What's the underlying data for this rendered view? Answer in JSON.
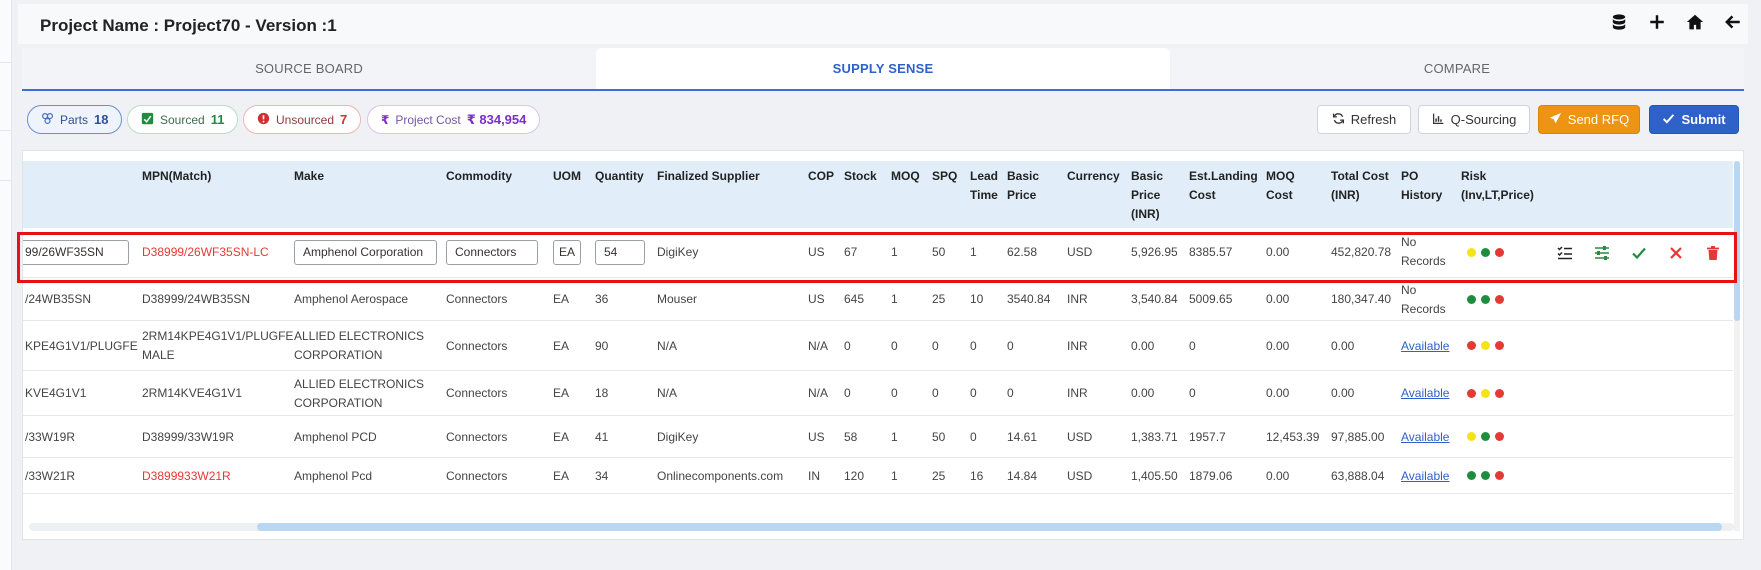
{
  "header": {
    "title": "Project Name : Project70 - Version :1"
  },
  "tabs": [
    {
      "label": "SOURCE BOARD",
      "active": false
    },
    {
      "label": "SUPPLY SENSE",
      "active": true
    },
    {
      "label": "COMPARE",
      "active": false
    }
  ],
  "stats": {
    "parts": {
      "label": "Parts",
      "value": "18"
    },
    "sourced": {
      "label": "Sourced",
      "value": "11"
    },
    "unsourced": {
      "label": "Unsourced",
      "value": "7"
    },
    "cost": {
      "label": "Project Cost",
      "value": "₹ 834,954"
    }
  },
  "buttons": {
    "refresh": "Refresh",
    "qsourcing": "Q-Sourcing",
    "send_rfq": "Send RFQ",
    "submit": "Submit"
  },
  "table": {
    "headers": {
      "mpn_match": "MPN(Match)",
      "make": "Make",
      "commodity": "Commodity",
      "uom": "UOM",
      "quantity": "Quantity",
      "supplier": "Finalized Supplier",
      "cop": "COP",
      "stock": "Stock",
      "moq": "MOQ",
      "spq": "SPQ",
      "lead_time": [
        "Lead",
        "Time"
      ],
      "basic_price": [
        "Basic",
        "Price"
      ],
      "currency": "Currency",
      "basic_price_inr": [
        "Basic",
        "Price",
        "(INR)"
      ],
      "est_landing": [
        "Est.Landing",
        "Cost"
      ],
      "moq_cost": [
        "MOQ",
        "Cost"
      ],
      "total_cost": [
        "Total Cost",
        "(INR)"
      ],
      "po_history": [
        "PO",
        "History"
      ],
      "risk": [
        "Risk",
        "(Inv,LT,Price)"
      ]
    },
    "edit_row": {
      "mpn_input": "99/26WF35SN",
      "mpn_match": "D38999/26WF35SN-LC",
      "make_input": "Amphenol Corporation",
      "commodity_input": "Connectors",
      "uom_input": "EA",
      "qty_input": "54",
      "supplier": "DigiKey",
      "cop": "US",
      "stock": "67",
      "moq": "1",
      "spq": "50",
      "lead": "1",
      "basic_price": "62.58",
      "currency": "USD",
      "basic_inr": "5,926.95",
      "est_landing": "8385.57",
      "moq_cost": "0.00",
      "total_cost": "452,820.78",
      "po_history": [
        "No",
        "Records"
      ],
      "risk": [
        "#f5e21b",
        "#1e8e3e",
        "#e53935"
      ]
    },
    "rows": [
      {
        "mpn": "/24WB35SN",
        "match": [
          "D38999/24WB35SN"
        ],
        "match_red": false,
        "make": [
          "Amphenol Aerospace"
        ],
        "commodity": "Connectors",
        "uom": "EA",
        "qty": "36",
        "supplier": "Mouser",
        "cop": "US",
        "stock": "645",
        "moq": "1",
        "spq": "25",
        "lead": "10",
        "basic_price": "3540.84",
        "currency": "INR",
        "basic_inr": "3,540.84",
        "est_landing": "5009.65",
        "moq_cost": "0.00",
        "total_cost": "180,347.40",
        "po_history": [
          "No",
          "Records"
        ],
        "po_link": false,
        "risk": [
          "#1e8e3e",
          "#1e8e3e",
          "#e53935"
        ]
      },
      {
        "mpn": "KPE4G1V1/PLUGFE",
        "match": [
          "2RM14KPE4G1V1/PLUGFE",
          "MALE"
        ],
        "match_red": false,
        "make": [
          "ALLIED ELECTRONICS",
          "CORPORATION"
        ],
        "commodity": "Connectors",
        "uom": "EA",
        "qty": "90",
        "supplier": "N/A",
        "cop": "N/A",
        "stock": "0",
        "moq": "0",
        "spq": "0",
        "lead": "0",
        "basic_price": "0",
        "currency": "INR",
        "basic_inr": "0.00",
        "est_landing": "0",
        "moq_cost": "0.00",
        "total_cost": "0.00",
        "po_history": [
          "Available"
        ],
        "po_link": true,
        "risk": [
          "#e53935",
          "#f5e21b",
          "#e53935"
        ]
      },
      {
        "mpn": "KVE4G1V1",
        "match": [
          "2RM14KVE4G1V1"
        ],
        "match_red": false,
        "make": [
          "ALLIED ELECTRONICS",
          "CORPORATION"
        ],
        "commodity": "Connectors",
        "uom": "EA",
        "qty": "18",
        "supplier": "N/A",
        "cop": "N/A",
        "stock": "0",
        "moq": "0",
        "spq": "0",
        "lead": "0",
        "basic_price": "0",
        "currency": "INR",
        "basic_inr": "0.00",
        "est_landing": "0",
        "moq_cost": "0.00",
        "total_cost": "0.00",
        "po_history": [
          "Available"
        ],
        "po_link": true,
        "risk": [
          "#e53935",
          "#f5e21b",
          "#e53935"
        ]
      },
      {
        "mpn": "/33W19R",
        "match": [
          "D38999/33W19R"
        ],
        "match_red": false,
        "make": [
          "Amphenol PCD"
        ],
        "commodity": "Connectors",
        "uom": "EA",
        "qty": "41",
        "supplier": "DigiKey",
        "cop": "US",
        "stock": "58",
        "moq": "1",
        "spq": "50",
        "lead": "0",
        "basic_price": "14.61",
        "currency": "USD",
        "basic_inr": "1,383.71",
        "est_landing": "1957.7",
        "moq_cost": "12,453.39",
        "total_cost": "97,885.00",
        "po_history": [
          "Available"
        ],
        "po_link": true,
        "risk": [
          "#f5e21b",
          "#1e8e3e",
          "#e53935"
        ]
      },
      {
        "mpn": "/33W21R",
        "match": [
          "D3899933W21R"
        ],
        "match_red": true,
        "make": [
          "Amphenol Pcd"
        ],
        "commodity": "Connectors",
        "uom": "EA",
        "qty": "34",
        "supplier": "Onlinecomponents.com",
        "cop": "IN",
        "stock": "120",
        "moq": "1",
        "spq": "25",
        "lead": "16",
        "basic_price": "14.84",
        "currency": "USD",
        "basic_inr": "1,405.50",
        "est_landing": "1879.06",
        "moq_cost": "0.00",
        "total_cost": "63,888.04",
        "po_history": [
          "Available"
        ],
        "po_link": true,
        "risk": [
          "#1e8e3e",
          "#1e8e3e",
          "#e53935"
        ]
      }
    ]
  }
}
